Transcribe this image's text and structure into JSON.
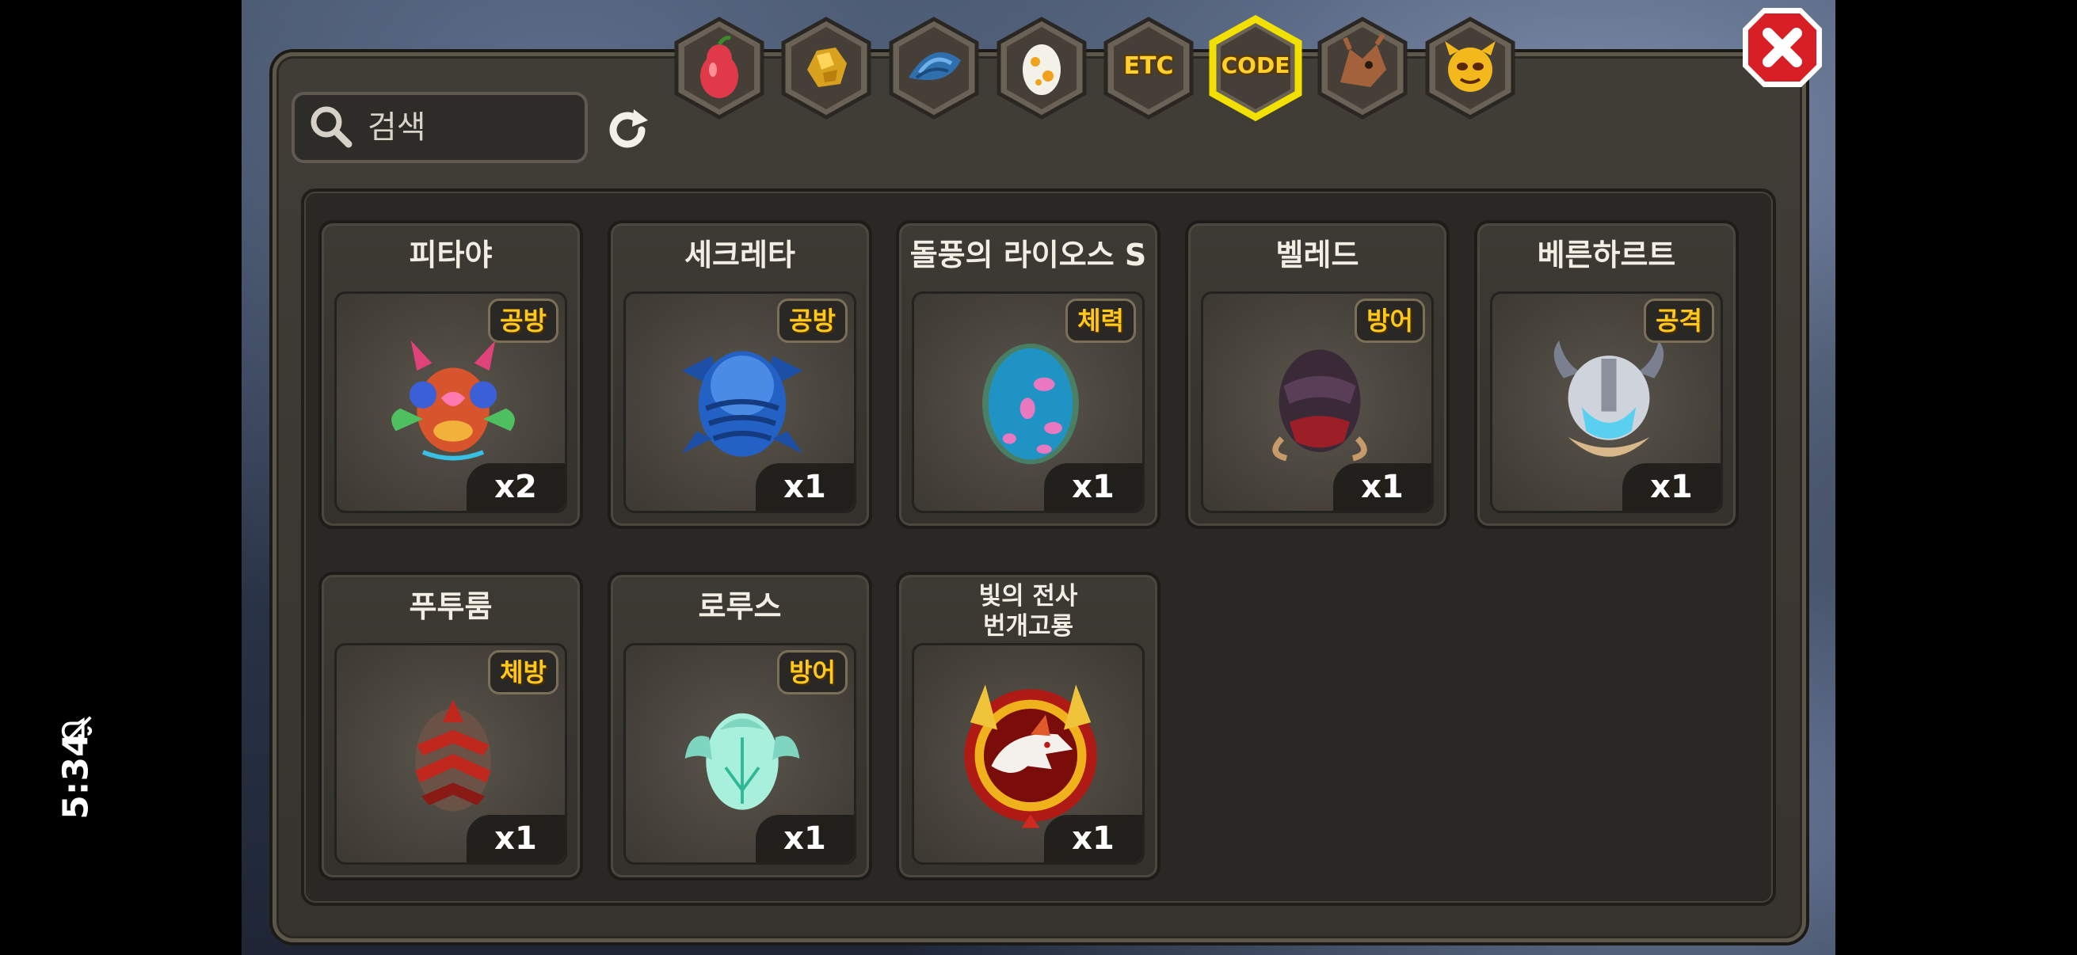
{
  "status_bar": {
    "time": "5:34"
  },
  "search": {
    "placeholder": "검색",
    "value": ""
  },
  "tabs": [
    {
      "id": "fruit",
      "label": "",
      "icon": "pear-icon",
      "selected": false
    },
    {
      "id": "gold",
      "label": "",
      "icon": "gold-ore-icon",
      "selected": false
    },
    {
      "id": "scale",
      "label": "",
      "icon": "dragon-scale-icon",
      "selected": false
    },
    {
      "id": "egg",
      "label": "",
      "icon": "egg-icon",
      "selected": false
    },
    {
      "id": "etc",
      "label": "ETC",
      "icon": "",
      "selected": false
    },
    {
      "id": "code",
      "label": "CODE",
      "icon": "",
      "selected": true
    },
    {
      "id": "dragon",
      "label": "",
      "icon": "dragon-head-icon",
      "selected": false
    },
    {
      "id": "monster",
      "label": "",
      "icon": "monster-face-icon",
      "selected": false
    }
  ],
  "items": [
    {
      "name": "피타야",
      "stat": "공방",
      "quantity": "x2",
      "icon": "flower-dragon-egg-icon"
    },
    {
      "name": "세크레타",
      "stat": "공방",
      "quantity": "x1",
      "icon": "blue-scaled-egg-icon"
    },
    {
      "name": "돌풍의 라이오스 S",
      "stat": "체력",
      "quantity": "x1",
      "icon": "spotted-egg-icon"
    },
    {
      "name": "벨레드",
      "stat": "방어",
      "quantity": "x1",
      "icon": "dark-armored-egg-icon"
    },
    {
      "name": "베른하르트",
      "stat": "공격",
      "quantity": "x1",
      "icon": "viking-helmet-egg-icon"
    },
    {
      "name": "푸투룸",
      "stat": "체방",
      "quantity": "x1",
      "icon": "red-spiked-egg-icon"
    },
    {
      "name": "로루스",
      "stat": "방어",
      "quantity": "x1",
      "icon": "winged-mint-egg-icon"
    },
    {
      "name": "빛의 전사\n번개고룡",
      "stat": "",
      "quantity": "x1",
      "icon": "lightning-dragon-emblem-icon"
    }
  ],
  "colors": {
    "badge_text": "#ffc91c",
    "tab_selected_outline": "#f2e100",
    "close_button": "#d81f26"
  }
}
